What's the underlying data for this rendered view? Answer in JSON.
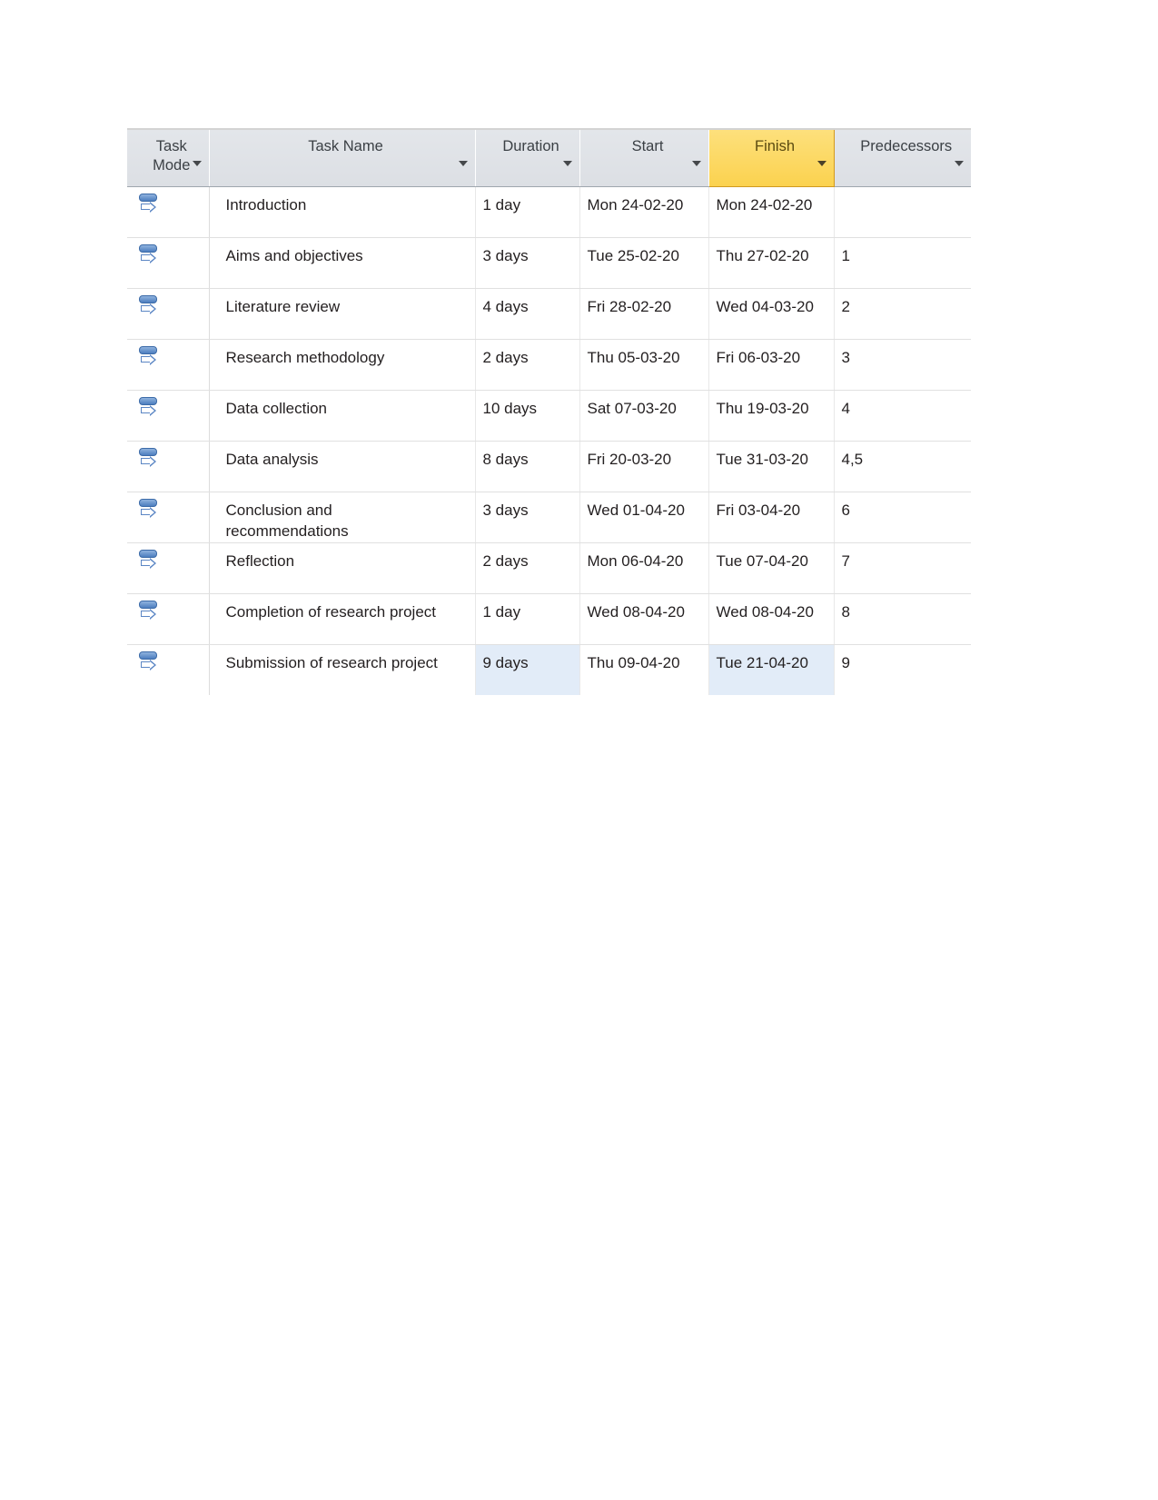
{
  "table": {
    "columns": [
      {
        "key": "mode",
        "label": "Task\nMode",
        "highlighted": false,
        "has_filter_arrow": true
      },
      {
        "key": "name",
        "label": "Task Name",
        "highlighted": false,
        "has_filter_arrow": true
      },
      {
        "key": "dur",
        "label": "Duration",
        "highlighted": false,
        "has_filter_arrow": true
      },
      {
        "key": "start",
        "label": "Start",
        "highlighted": false,
        "has_filter_arrow": true
      },
      {
        "key": "fin",
        "label": "Finish",
        "highlighted": true,
        "has_filter_arrow": true
      },
      {
        "key": "pred",
        "label": "Predecessors",
        "highlighted": false,
        "has_filter_arrow": true
      }
    ],
    "rows": [
      {
        "mode_icon": "auto-scheduled-icon",
        "name": "Introduction",
        "duration": "1 day",
        "start": "Mon 24-02-20",
        "finish": "Mon 24-02-20",
        "predecessors": "",
        "selected_cells": []
      },
      {
        "mode_icon": "auto-scheduled-icon",
        "name": "Aims and objectives",
        "duration": "3 days",
        "start": "Tue 25-02-20",
        "finish": "Thu 27-02-20",
        "predecessors": "1",
        "selected_cells": []
      },
      {
        "mode_icon": "auto-scheduled-icon",
        "name": "Literature review",
        "duration": "4 days",
        "start": "Fri 28-02-20",
        "finish": "Wed 04-03-20",
        "predecessors": "2",
        "selected_cells": []
      },
      {
        "mode_icon": "auto-scheduled-icon",
        "name": "Research methodology",
        "duration": "2 days",
        "start": "Thu 05-03-20",
        "finish": "Fri 06-03-20",
        "predecessors": "3",
        "selected_cells": []
      },
      {
        "mode_icon": "auto-scheduled-icon",
        "name": "Data collection",
        "duration": "10 days",
        "start": "Sat 07-03-20",
        "finish": "Thu 19-03-20",
        "predecessors": "4",
        "selected_cells": []
      },
      {
        "mode_icon": "auto-scheduled-icon",
        "name": "Data analysis",
        "duration": "8 days",
        "start": "Fri 20-03-20",
        "finish": "Tue 31-03-20",
        "predecessors": "4,5",
        "selected_cells": []
      },
      {
        "mode_icon": "auto-scheduled-icon",
        "name": "Conclusion and\nrecommendations",
        "duration": "3 days",
        "start": "Wed 01-04-20",
        "finish": "Fri 03-04-20",
        "predecessors": "6",
        "selected_cells": []
      },
      {
        "mode_icon": "auto-scheduled-icon",
        "name": "Reflection",
        "duration": "2 days",
        "start": "Mon 06-04-20",
        "finish": "Tue 07-04-20",
        "predecessors": "7",
        "selected_cells": []
      },
      {
        "mode_icon": "auto-scheduled-icon",
        "name": "Completion of research project",
        "duration": "1 day",
        "start": "Wed 08-04-20",
        "finish": "Wed 08-04-20",
        "predecessors": "8",
        "selected_cells": []
      },
      {
        "mode_icon": "auto-scheduled-icon",
        "name": "Submission of research project",
        "duration": "9 days",
        "start": "Thu 09-04-20",
        "finish": "Tue 21-04-20",
        "predecessors": "9",
        "selected_cells": [
          "dur",
          "fin"
        ]
      }
    ]
  },
  "colors": {
    "header_background": "#dfe3e8",
    "header_highlight": "#fcd963",
    "header_highlight_border": "#d39a1d",
    "selection_blue": "#e2ecf8",
    "grid_line": "#e0e0e0",
    "task_mode_icon_blue": "#4d7ebf",
    "text": "#231f20",
    "page_background": "#ffffff"
  }
}
